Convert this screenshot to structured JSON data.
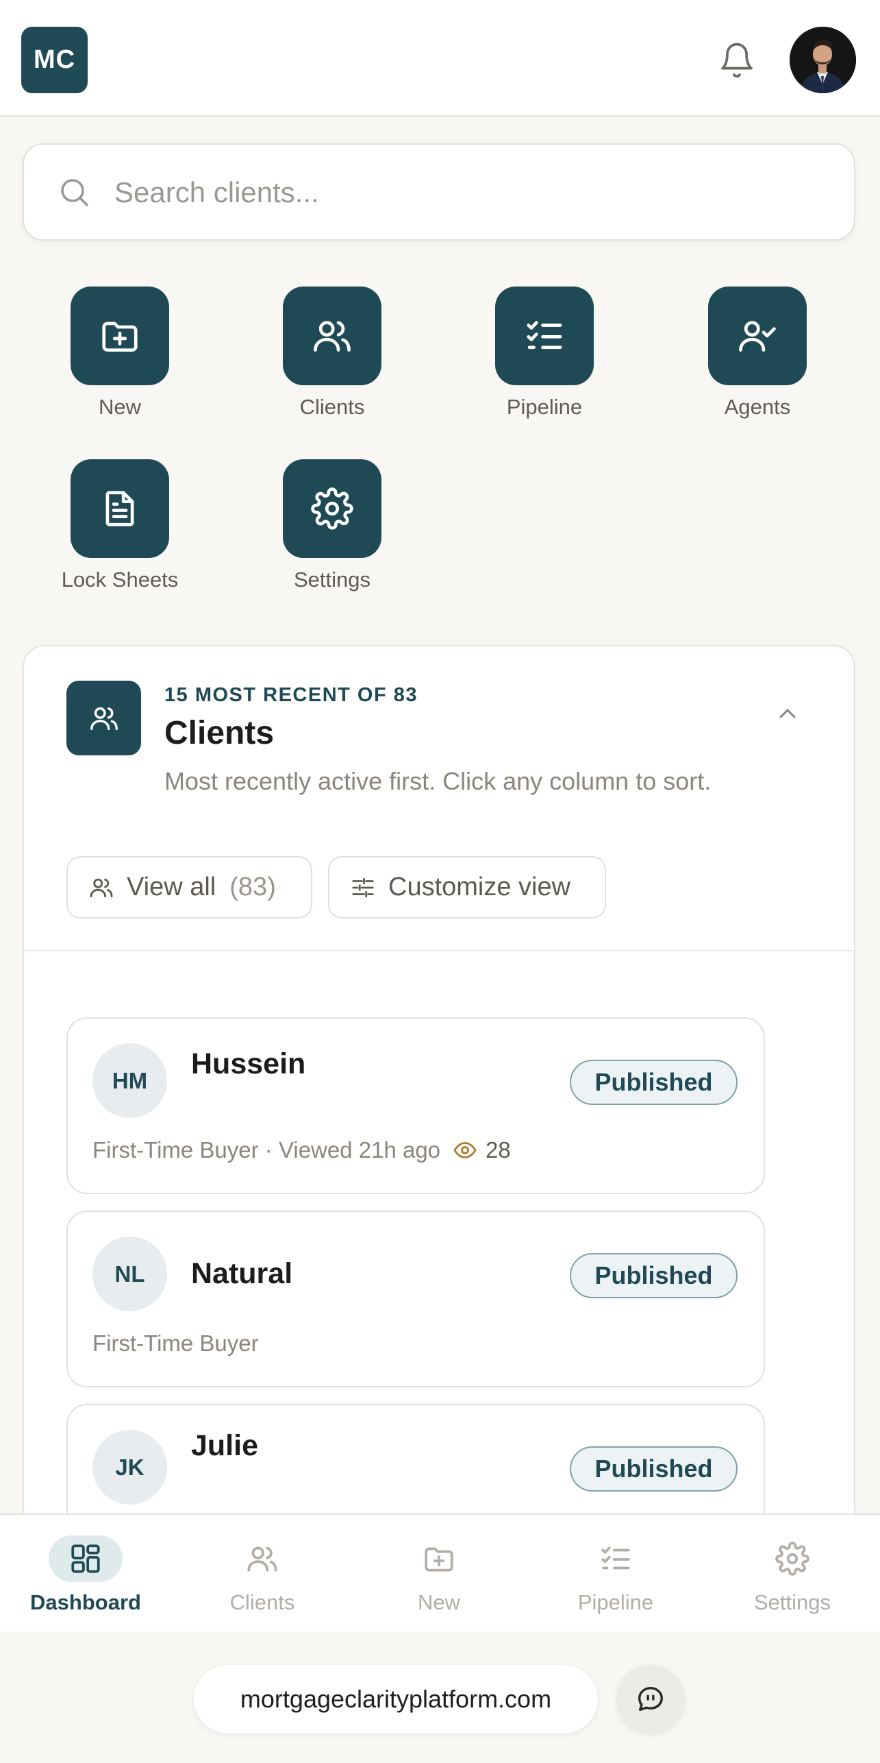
{
  "app": {
    "logo_text": "MC"
  },
  "header": {
    "bell_icon": "bell-icon",
    "avatar": "user-avatar-photo"
  },
  "search": {
    "placeholder": "Search clients...",
    "value": ""
  },
  "quick_actions": [
    {
      "label": "New",
      "icon": "folder-plus-icon"
    },
    {
      "label": "Clients",
      "icon": "users-icon"
    },
    {
      "label": "Pipeline",
      "icon": "list-checks-icon"
    },
    {
      "label": "Agents",
      "icon": "user-check-icon"
    },
    {
      "label": "Lock Sheets",
      "icon": "document-icon"
    },
    {
      "label": "Settings",
      "icon": "gear-icon"
    }
  ],
  "clients_card": {
    "eyebrow": "15 MOST RECENT OF 83",
    "title": "Clients",
    "subtitle": "Most recently active first. Click any column to sort.",
    "view_all_label": "View all",
    "view_all_count": "(83)",
    "customize_label": "Customize view"
  },
  "clients": [
    {
      "initials": "HM",
      "name": "Hussein",
      "status": "Published",
      "meta": "First-Time Buyer · Viewed 21h ago",
      "views": "28"
    },
    {
      "initials": "NL",
      "name": "Natural",
      "status": "Published",
      "meta": "First-Time Buyer"
    },
    {
      "initials": "JK",
      "name": "Julie",
      "status": "Published"
    }
  ],
  "bottom_nav": [
    {
      "label": "Dashboard",
      "icon": "grid-icon",
      "active": true
    },
    {
      "label": "Clients",
      "icon": "users-icon",
      "active": false
    },
    {
      "label": "New",
      "icon": "folder-plus-icon",
      "active": false
    },
    {
      "label": "Pipeline",
      "icon": "list-checks-icon",
      "active": false
    },
    {
      "label": "Settings",
      "icon": "gear-icon",
      "active": false
    }
  ],
  "browser": {
    "url": "mortgageclarityplatform.com",
    "chat_icon": "chat-icon"
  },
  "colors": {
    "brand": "#1f4a55",
    "badge_bg": "#edf3f4",
    "muted_text": "#8a857d"
  }
}
